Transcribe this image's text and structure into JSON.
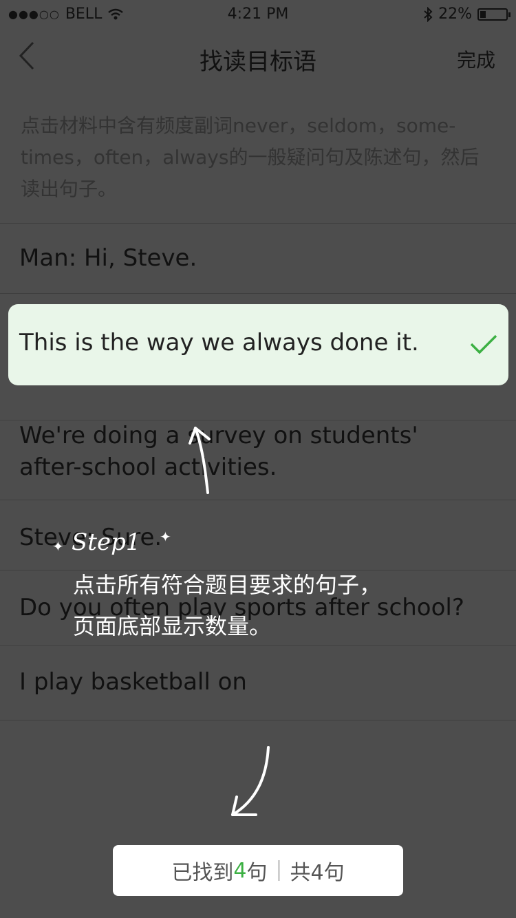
{
  "status": {
    "carrier": "BELL",
    "time": "4:21 PM",
    "battery": "22%",
    "signal_dots": "●●●○○"
  },
  "nav": {
    "back_glyph": "‹",
    "title": "找读目标语",
    "done": "完成"
  },
  "instruction": "点击材料中含有频度副词never，seldom，some-times，often，always的一般疑问句及陈述句，然后读出句子。",
  "sentences": [
    "Man: Hi, Steve.",
    "This is the way we always done it.",
    "We're doing a survey on students' after-school activities.",
    "Steve: Sure.",
    "Do you often play sports after school?",
    "I play basketball on"
  ],
  "guide": {
    "step": "Step1",
    "line1": "点击所有符合题目要求的句子，",
    "line2": "页面底部显示数量。"
  },
  "footer": {
    "found_prefix": "已找到",
    "found_count": "4",
    "found_suffix": "句",
    "total": "共4句"
  },
  "colors": {
    "overlay_bg": "#4d4d4d",
    "highlight_bg": "#e9f6e9",
    "accent_green": "#3cb043"
  }
}
